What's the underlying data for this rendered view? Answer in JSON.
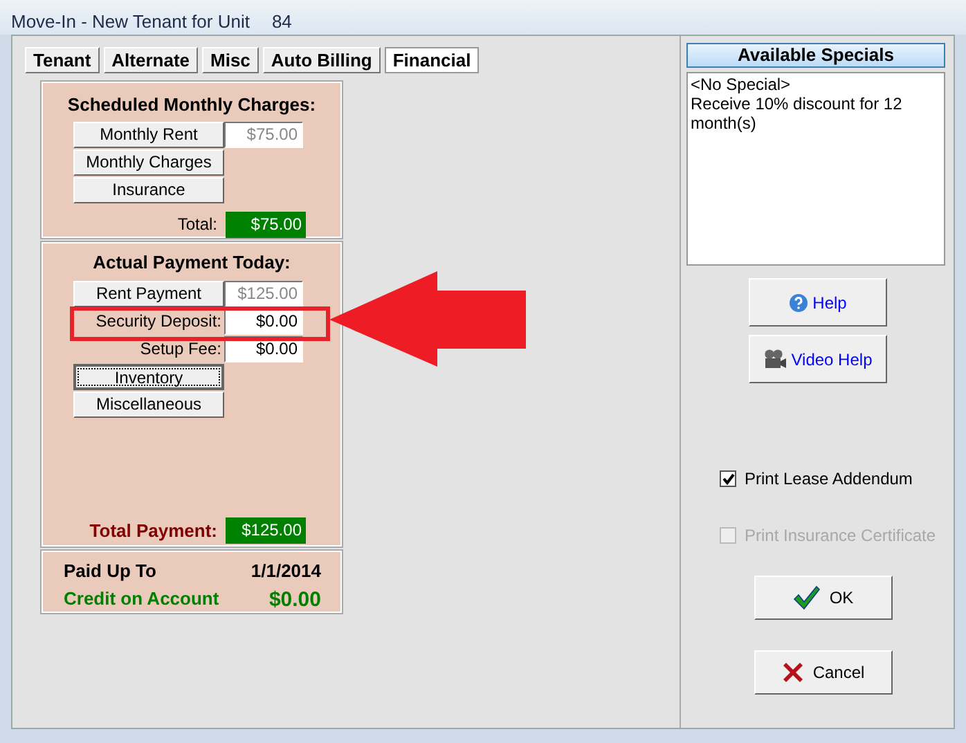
{
  "window": {
    "title": "Move-In - New Tenant for Unit",
    "unit": "84"
  },
  "tabs": [
    {
      "label": "Tenant",
      "selected": false
    },
    {
      "label": "Alternate",
      "selected": false
    },
    {
      "label": "Misc",
      "selected": false
    },
    {
      "label": "Auto Billing",
      "selected": false
    },
    {
      "label": "Financial",
      "selected": true
    }
  ],
  "scheduled": {
    "title": "Scheduled Monthly Charges:",
    "rows": [
      {
        "kind": "button",
        "label": "Monthly Rent",
        "value": "$75.00",
        "readonly": true
      },
      {
        "kind": "button",
        "label": "Monthly Charges"
      },
      {
        "kind": "button",
        "label": "Insurance"
      }
    ],
    "total_label": "Total:",
    "total": "$75.00"
  },
  "payment": {
    "title": "Actual Payment Today:",
    "rows": [
      {
        "kind": "button",
        "label": "Rent Payment",
        "value": "$125.00",
        "readonly": true
      },
      {
        "kind": "label",
        "label": "Security Deposit:",
        "value": "$0.00",
        "readonly": false
      },
      {
        "kind": "label",
        "label": "Setup Fee:",
        "value": "$0.00",
        "readonly": false
      },
      {
        "kind": "button",
        "label": "Inventory",
        "focused": true
      },
      {
        "kind": "button",
        "label": "Miscellaneous",
        "focused": false
      }
    ],
    "total_label": "Total Payment:",
    "total": "$125.00"
  },
  "summary": [
    {
      "kind": "plain",
      "label": "Paid Up To",
      "value": "1/1/2014"
    },
    {
      "kind": "credit",
      "label": "Credit on Account",
      "value": "$0.00"
    }
  ],
  "specials": {
    "title": "Available Specials",
    "items": [
      "<No Special>",
      "Receive 10% discount for 12 month(s)"
    ]
  },
  "help_buttons": [
    {
      "kind": "help",
      "label": "Help"
    },
    {
      "kind": "video",
      "label": "Video Help"
    }
  ],
  "options": [
    {
      "label": "Print Lease Addendum",
      "checked": true,
      "disabled": false
    },
    {
      "label": "Print Insurance Certificate",
      "checked": false,
      "disabled": true
    }
  ],
  "actions": [
    {
      "kind": "ok",
      "label": "OK"
    },
    {
      "kind": "cancel",
      "label": "Cancel"
    }
  ]
}
